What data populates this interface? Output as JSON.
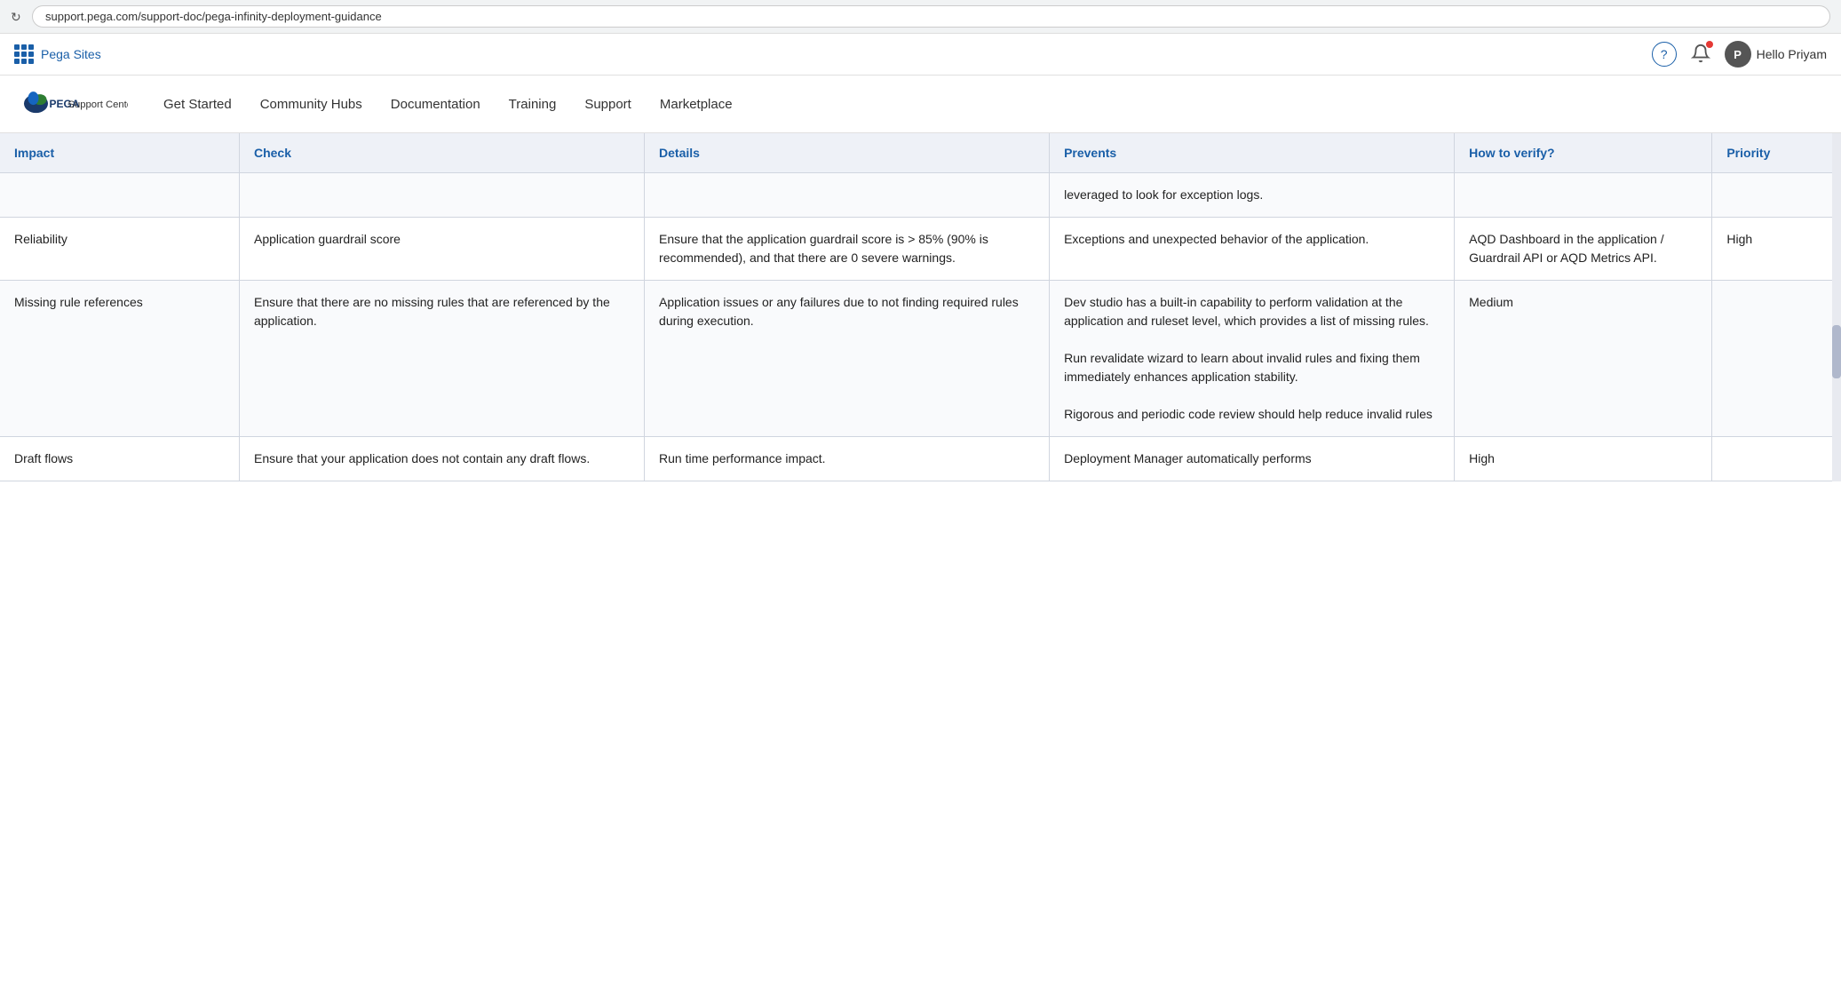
{
  "browser": {
    "url": "support.pega.com/support-doc/pega-infinity-deployment-guidance",
    "reload_icon": "↻"
  },
  "topbar": {
    "brand": "Pega Sites",
    "help_icon": "?",
    "user_name": "Hello Priyam",
    "user_initials": "P"
  },
  "nav": {
    "logo_text": "PEGA Support Center",
    "links": [
      {
        "label": "Get Started"
      },
      {
        "label": "Community Hubs"
      },
      {
        "label": "Documentation"
      },
      {
        "label": "Training"
      },
      {
        "label": "Support"
      },
      {
        "label": "Marketplace"
      }
    ]
  },
  "table": {
    "columns": [
      {
        "id": "impact",
        "label": "Impact"
      },
      {
        "id": "check",
        "label": "Check"
      },
      {
        "id": "details",
        "label": "Details"
      },
      {
        "id": "prevents",
        "label": "Prevents"
      },
      {
        "id": "verify",
        "label": "How to verify?"
      },
      {
        "id": "priority",
        "label": "Priority"
      }
    ],
    "rows": [
      {
        "impact": "",
        "check": "",
        "details": "",
        "prevents": "leveraged to look for exception logs.",
        "verify": "",
        "priority": ""
      },
      {
        "impact": "Reliability",
        "check": "Application guardrail score",
        "details": "Ensure that the application guardrail score is > 85% (90% is recommended), and that there are 0 severe warnings.",
        "prevents": "Exceptions and unexpected behavior of the application.",
        "verify": "AQD Dashboard in the application / Guardrail API or AQD Metrics API.",
        "priority": "High"
      },
      {
        "impact": "Missing rule references",
        "check": "Ensure that there are no missing rules that are referenced by the application.",
        "details": "Application issues or any failures due to not finding required rules during execution.",
        "prevents": "Dev studio has a built-in capability to perform validation at the application and ruleset level, which provides a list of missing rules.\nRun revalidate wizard to learn about invalid rules and fixing them immediately enhances application stability.\n\nRigorous and periodic code review should help reduce invalid rules",
        "verify": "Medium",
        "priority": ""
      },
      {
        "impact": "Draft flows",
        "check": "Ensure that your application does not contain any draft flows.",
        "details": "Run time performance impact.",
        "prevents": "Deployment Manager automatically performs",
        "verify": "High",
        "priority": ""
      }
    ]
  }
}
